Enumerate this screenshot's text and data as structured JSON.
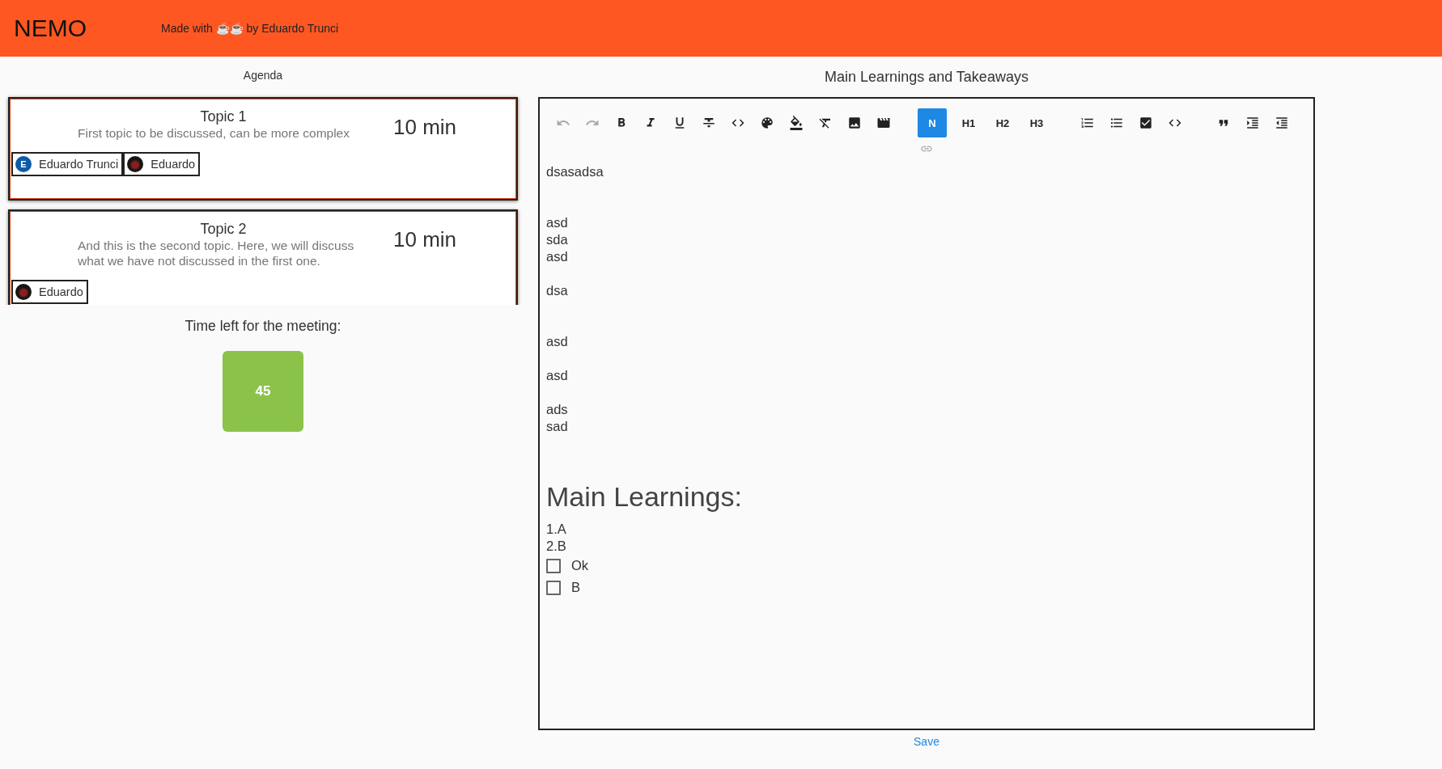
{
  "header": {
    "logo": "NEMO",
    "tagline": "Made with ☕☕ by Eduardo Trunci"
  },
  "agenda": {
    "title": "Agenda",
    "topics": [
      {
        "title": "Topic 1",
        "description": "First topic to be discussed, can be more complex",
        "duration": "10 min",
        "participants": [
          {
            "name": "Eduardo Trunci",
            "avatar": {
              "kind": "letter",
              "letter": "E",
              "color": "#0d5ca8"
            }
          },
          {
            "name": "Eduardo",
            "avatar": {
              "kind": "image"
            }
          }
        ]
      },
      {
        "title": "Topic 2",
        "description": "And this is the second topic. Here, we will discuss what we have not discussed in the first one.",
        "duration": "10 min",
        "participants": [
          {
            "name": "Eduardo",
            "avatar": {
              "kind": "image"
            }
          }
        ]
      }
    ]
  },
  "timer": {
    "label": "Time left for the meeting:",
    "value": "45"
  },
  "notes": {
    "title": "Main Learnings and Takeaways",
    "toolbar": [
      {
        "buttons": [
          {
            "kind": "undo",
            "disabled": true
          },
          {
            "kind": "redo",
            "disabled": true
          },
          {
            "kind": "bold",
            "disabled": false
          },
          {
            "kind": "italic",
            "disabled": false
          },
          {
            "kind": "underline",
            "disabled": false
          },
          {
            "kind": "strikethrough",
            "disabled": false
          },
          {
            "kind": "code",
            "disabled": false
          },
          {
            "kind": "palette",
            "disabled": false
          },
          {
            "kind": "fill",
            "disabled": false
          },
          {
            "kind": "clear",
            "disabled": false
          },
          {
            "kind": "image",
            "disabled": false
          },
          {
            "kind": "video",
            "disabled": false
          }
        ]
      },
      {
        "buttons": [
          {
            "kind": "text",
            "label": "N",
            "selected": true
          },
          {
            "kind": "text",
            "label": "H1",
            "selected": false
          },
          {
            "kind": "text",
            "label": "H2",
            "selected": false
          },
          {
            "kind": "text",
            "label": "H3",
            "selected": false
          }
        ]
      },
      {
        "buttons": [
          {
            "kind": "ordered-list",
            "disabled": false
          },
          {
            "kind": "bullet-list",
            "disabled": false
          },
          {
            "kind": "checklist",
            "disabled": false
          },
          {
            "kind": "code",
            "disabled": false
          }
        ]
      },
      {
        "buttons": [
          {
            "kind": "quote",
            "disabled": false
          },
          {
            "kind": "indent",
            "disabled": false
          },
          {
            "kind": "outdent",
            "disabled": false
          }
        ]
      }
    ],
    "link": {
      "disabled": true
    },
    "lines": [
      {
        "kind": "p",
        "text": "dsasadsa"
      },
      {
        "kind": "blank"
      },
      {
        "kind": "blank"
      },
      {
        "kind": "p",
        "text": "asd"
      },
      {
        "kind": "p",
        "text": "sda"
      },
      {
        "kind": "p",
        "text": "asd"
      },
      {
        "kind": "blank"
      },
      {
        "kind": "p",
        "text": "dsa"
      },
      {
        "kind": "blank"
      },
      {
        "kind": "blank"
      },
      {
        "kind": "p",
        "text": "asd"
      },
      {
        "kind": "blank"
      },
      {
        "kind": "p",
        "text": "asd"
      },
      {
        "kind": "blank"
      },
      {
        "kind": "p",
        "text": "ads"
      },
      {
        "kind": "p",
        "text": "sad"
      },
      {
        "kind": "blank"
      },
      {
        "kind": "blank"
      },
      {
        "kind": "h1",
        "text": "Main Learnings:"
      },
      {
        "kind": "p",
        "text": "1.A"
      },
      {
        "kind": "p",
        "text": "2.B"
      },
      {
        "kind": "check",
        "text": "Ok",
        "checked": false
      },
      {
        "kind": "check",
        "text": "B",
        "checked": false
      }
    ],
    "save": "Save"
  }
}
